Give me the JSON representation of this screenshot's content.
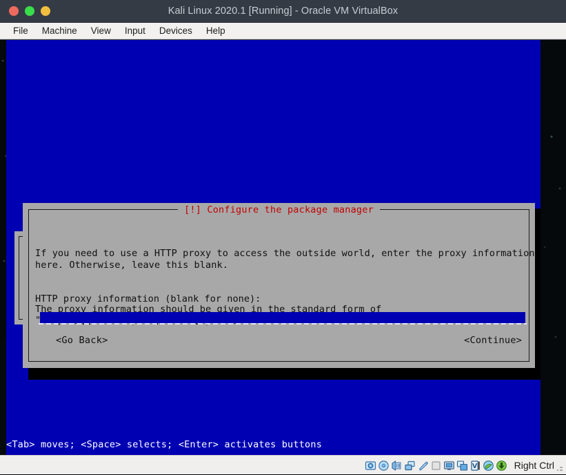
{
  "window": {
    "title": "Kali Linux 2020.1 [Running] - Oracle VM VirtualBox",
    "controls": [
      {
        "name": "close-button",
        "color": "#ed6a5f"
      },
      {
        "name": "minimize-button",
        "color": "#3ade4a"
      },
      {
        "name": "maximize-button",
        "color": "#f0bf3f"
      }
    ]
  },
  "menubar": {
    "items": [
      {
        "label": "File"
      },
      {
        "label": "Machine"
      },
      {
        "label": "View"
      },
      {
        "label": "Input"
      },
      {
        "label": "Devices"
      },
      {
        "label": "Help"
      }
    ]
  },
  "console": {
    "background_color": "#0000b3",
    "hint": "<Tab> moves; <Space> selects; <Enter> activates buttons"
  },
  "dialog": {
    "title": "[!] Configure the package manager",
    "title_color": "#c00000",
    "background_color": "#a8a8a8",
    "paragraphs": [
      "If you need to use a HTTP proxy to access the outside world, enter the proxy information\nhere. Otherwise, leave this blank.",
      "The proxy information should be given in the standard form of\n\"http://[[user][:pass]@]host[:port]/\"."
    ],
    "field_label": "HTTP proxy information (blank for none):",
    "input": {
      "value": "",
      "placeholder": "",
      "background_color": "#0000b3"
    },
    "buttons": [
      {
        "name": "go-back-button",
        "label": "<Go Back>"
      },
      {
        "name": "continue-button",
        "label": "<Continue>"
      }
    ]
  },
  "statusbar": {
    "host_key": "Right Ctrl",
    "icons": [
      {
        "name": "hard-disk-icon"
      },
      {
        "name": "optical-drive-icon"
      },
      {
        "name": "floppy-drive-icon"
      },
      {
        "name": "network-icon"
      },
      {
        "name": "usb-icon"
      },
      {
        "name": "shared-folders-icon"
      },
      {
        "name": "display-icon"
      },
      {
        "name": "recording-icon"
      },
      {
        "name": "virtualization-icon"
      },
      {
        "name": "mouse-integration-icon"
      },
      {
        "name": "keyboard-capture-icon"
      }
    ]
  }
}
